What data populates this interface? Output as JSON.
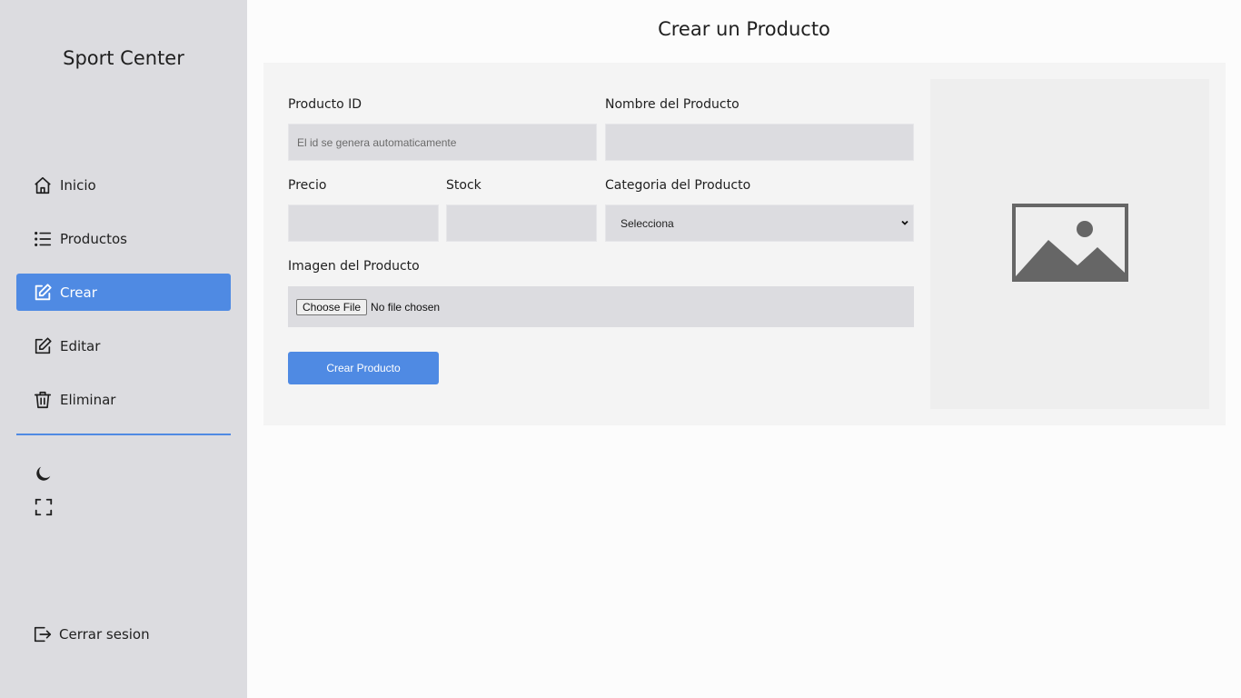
{
  "sidebar": {
    "brand": "Sport Center",
    "items": [
      {
        "label": "Inicio",
        "icon": "home-icon"
      },
      {
        "label": "Productos",
        "icon": "list-icon"
      },
      {
        "label": "Crear",
        "icon": "edit-square-icon",
        "active": true
      },
      {
        "label": "Editar",
        "icon": "edit-icon"
      },
      {
        "label": "Eliminar",
        "icon": "trash-icon"
      }
    ],
    "tools": [
      {
        "icon": "moon-icon"
      },
      {
        "icon": "fullscreen-icon"
      }
    ],
    "logout_label": "Cerrar sesion",
    "accent_color": "#4f8ae3"
  },
  "main": {
    "title": "Crear un Producto",
    "form": {
      "id_label": "Producto ID",
      "id_placeholder": "El id se genera automaticamente",
      "name_label": "Nombre del Producto",
      "name_value": "",
      "price_label": "Precio",
      "price_value": "",
      "stock_label": "Stock",
      "stock_value": "",
      "category_label": "Categoria del Producto",
      "category_selected": "Selecciona",
      "image_label": "Imagen del Producto",
      "file_button": "Choose File",
      "file_status": "No file chosen",
      "submit_label": "Crear Producto"
    },
    "preview": {
      "icon": "image-placeholder-icon"
    }
  }
}
